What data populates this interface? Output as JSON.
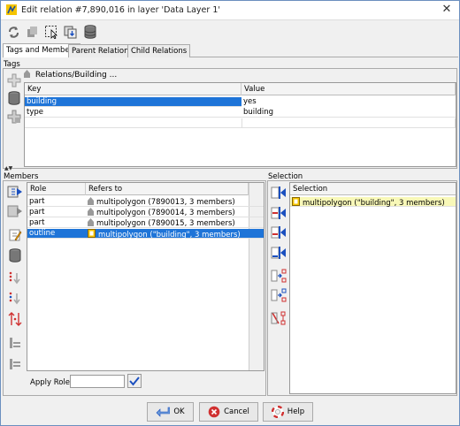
{
  "window": {
    "title": "Edit relation #7,890,016 in layer 'Data Layer 1'",
    "close_glyph": "✕"
  },
  "toolbar": {
    "buttons": [
      "refresh-icon",
      "copy-icon",
      "select-members-icon",
      "download-members-icon",
      "database-icon"
    ]
  },
  "tabs": [
    "Tags and Members",
    "Parent Relations",
    "Child Relations"
  ],
  "tags": {
    "section_label": "Tags",
    "preset_label": "Relations/Building ...",
    "columns": [
      "Key",
      "Value"
    ],
    "rows": [
      {
        "key": "building",
        "value": "yes",
        "selected": true
      },
      {
        "key": "type",
        "value": "building",
        "selected": false
      }
    ]
  },
  "members": {
    "section_label": "Members",
    "columns": [
      "Role",
      "Refers to"
    ],
    "rows": [
      {
        "role": "part",
        "refers_to": "multipolygon (7890013, 3 members)",
        "selected": false
      },
      {
        "role": "part",
        "refers_to": "multipolygon (7890014, 3 members)",
        "selected": false
      },
      {
        "role": "part",
        "refers_to": "multipolygon (7890015, 3 members)",
        "selected": false
      },
      {
        "role": "outline",
        "refers_to": "multipolygon (\"building\", 3 members)",
        "selected": true
      }
    ],
    "apply_role_label": "Apply Role:",
    "apply_role_value": ""
  },
  "selection": {
    "section_label": "Selection",
    "column": "Selection",
    "rows": [
      {
        "text": "multipolygon (\"building\", 3 members)"
      }
    ]
  },
  "buttons": {
    "ok": "OK",
    "cancel": "Cancel",
    "help": "Help"
  },
  "colors": {
    "selection_blue": "#1e74d8",
    "selection_yellow": "#f8f8b8",
    "accent_blue": "#1a4fbf",
    "arrow_red": "#d03030"
  }
}
